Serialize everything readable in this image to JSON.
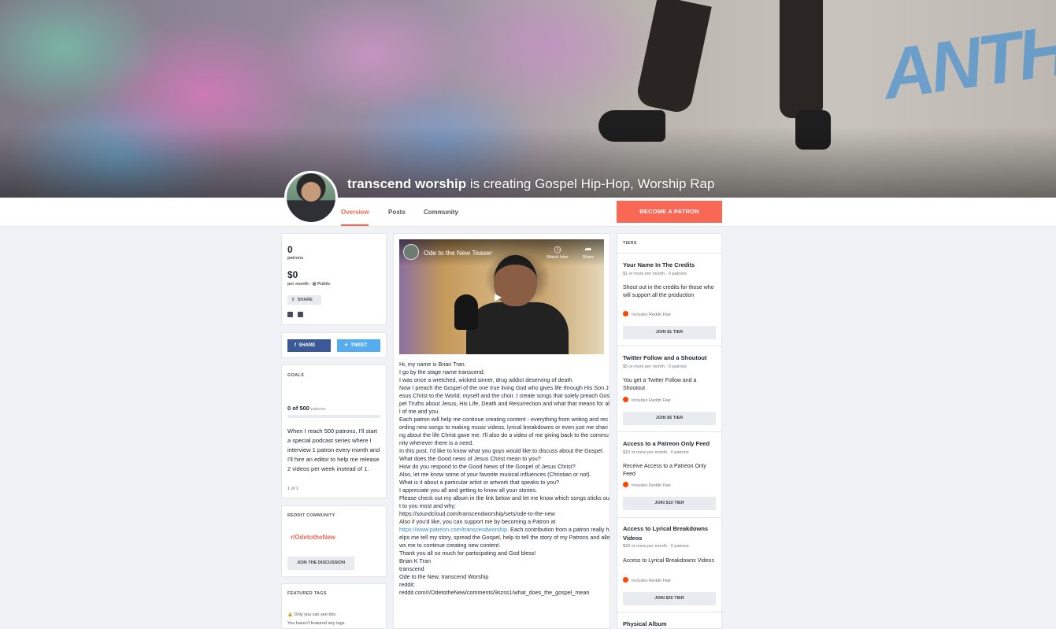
{
  "creator": {
    "name": "transcend worship",
    "creating_text": "is creating Gospel Hip-Hop, Worship Rap"
  },
  "nav": {
    "tabs": [
      "Overview",
      "Posts",
      "Community"
    ],
    "become_patron": "BECOME A PATRON"
  },
  "stats": {
    "patrons_count": "0",
    "patrons_label": "patrons",
    "earnings": "$0",
    "earnings_label": "per month",
    "visibility": "Public",
    "share_label": "SHARE"
  },
  "social": {
    "share": "SHARE",
    "tweet": "TWEET"
  },
  "goals": {
    "title": "GOALS",
    "progress": "0 of 500",
    "progress_unit": "patrons",
    "progress_fraction": 0,
    "description": "When I reach 500 patrons, I'll start a special podcast series where I interview 1 patron every month and I'll hire an editor to help me release 2 videos per week instead of 1.",
    "pager": "1 of 1"
  },
  "reddit": {
    "title": "REDDIT COMMUNITY",
    "subreddit": "r/OdetotheNew",
    "join_label": "JOIN THE DISCUSSION"
  },
  "featured_tags": {
    "title": "FEATURED TAGS",
    "only_you": "Only you can see this",
    "none": "You haven't featured any tags."
  },
  "video": {
    "title": "Ode to the New Teaser",
    "watch_later": "Watch later",
    "share": "Share"
  },
  "post": {
    "lines_before_link1": "Hi, my name is Brian Tran.\nI go by the stage name transcend.\nI was once a wretched, wicked sinner, drug addict deserving of death.\nNow I preach the Gospel of the one true living God who gives life through His Son Jesus Christ to the World, myself and the choir. I create songs that solely preach Gospel Truths about Jesus, His Life, Death and Resurrection and what that means for all of me and you.\nEach patron will help me continue creating content - everything from writing and recording new songs to making music videos, lyrical breakdowns or even just me sharing about the life Christ gave me. I'll also do a video of me giving back to the community wherever there is a need.\nIn this post, I'd like to know what you guys would like to discuss about the Gospel.\nWhat does the Good news of Jesus Christ mean to you?\nHow do you respond to the Good News of the Gospel of Jesus Christ?\nAlso, let me know some of your favorite musical influences (Christian or not).\nWhat is it about a particular artist or artwork that speaks to you?\nI appreciate you all and getting to know all your stories.\nPlease check out my album in the link below and let me know which songs sticks out to you most and why:\nhttps://soundcloud.com/transcendworship/sets/ode-to-the-new\nAlso if you'd like, you can support me by becoming a Patron at\n",
    "link1": "https://www.patreon.com/transcendworship",
    "lines_after_link1": ". Each contribution from a patron really helps me tell my story, spread the Gospel, help to tell the story of my Patrons and allows me to continue creating new content.\nThank you all so much for participating and God bless!\nBrian K Tran\ntranscend\nOde to the New, transcend Worship\nreddit:\n",
    "link2": "reddit.com/r/OdetotheNew/comments/9szss1/what_does_the_gospel_mean"
  },
  "tiers": {
    "title": "TIERS",
    "items": [
      {
        "name": "Your Name In The Credits",
        "price": "$1 or more per month · 0 patrons",
        "desc": "Shout out in the credits for those who will support all the production",
        "perk": "Includes Reddit Flair",
        "button": "JOIN $1 TIER"
      },
      {
        "name": "Twitter Follow and a Shoutout",
        "price": "$5 or more per month · 0 patrons",
        "desc": "You get a Twitter Follow and a Shoutout",
        "perk": "Includes Reddit Flair",
        "button": "JOIN $5 TIER"
      },
      {
        "name": "Access to a Patreon Only Feed",
        "price": "$10 or more per month · 0 patrons",
        "desc": "Receive Access to a Patreon Only Feed",
        "perk": "Includes Reddit Flair",
        "button": "JOIN $10 TIER"
      },
      {
        "name": "Access to Lyrical Breakdowns Videos",
        "price": "$20 or more per month · 0 patrons",
        "desc": "Access to Lyrical Breakdowns Videos",
        "perk": "Includes Reddit Flair",
        "button": "JOIN $20 TIER"
      },
      {
        "name": "Physical Album"
      }
    ]
  },
  "colors": {
    "accent": "#f96854",
    "facebook": "#3b5998",
    "twitter": "#55acee",
    "link": "#358ed1"
  }
}
